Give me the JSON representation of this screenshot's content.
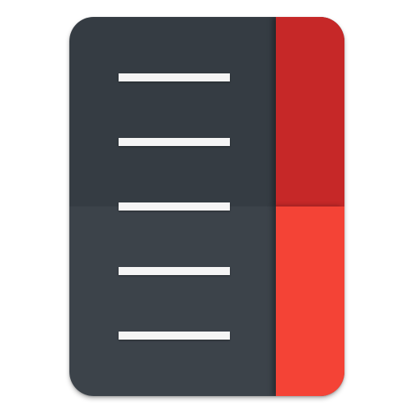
{
  "icon": {
    "name": "app-icon",
    "colors": {
      "panel_top": "#353c43",
      "panel_bottom": "#3c434a",
      "strip_top": "#c62828",
      "strip_bottom": "#f44336",
      "line": "#f5f5f5"
    },
    "lines": [
      {
        "name": "line-1"
      },
      {
        "name": "line-2"
      },
      {
        "name": "line-3"
      },
      {
        "name": "line-4"
      },
      {
        "name": "line-5"
      }
    ]
  }
}
